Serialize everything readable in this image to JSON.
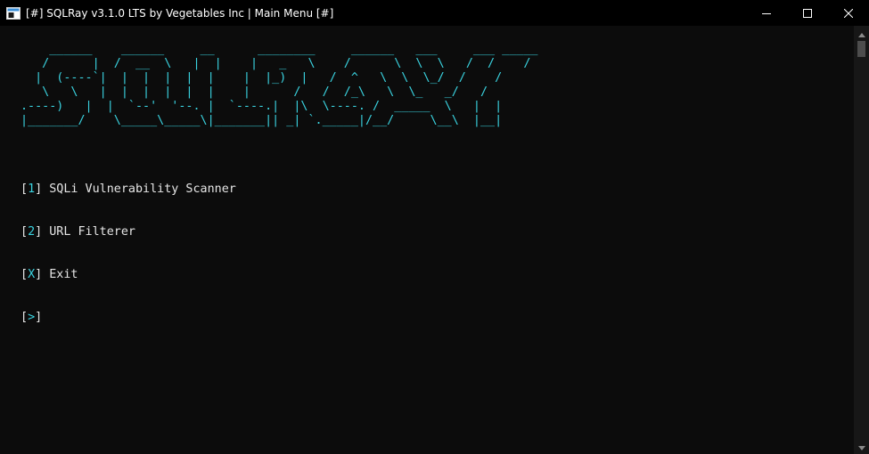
{
  "window": {
    "title": "[#] SQLRay v3.1.0 LTS by Vegetables Inc | Main Menu [#]",
    "app_icon": "console-icon",
    "controls": [
      "minimize-icon",
      "maximize-icon",
      "close-icon"
    ]
  },
  "console": {
    "banner_lines": [
      "    ______    ______     __      ________     ______   ___     ___ _____",
      "   /      |  /  __  \\   |  |    |   _   \\    /      \\  \\  \\   /  /    /",
      "  |  (----`|  |  |  |  |  |    |  |_)  |   /  ^   \\  \\  \\_/  /    /",
      "   \\   \\   |  |  |  |  |  |    |      /   /  /_\\   \\  \\_   _/   /",
      ".----)   |  |  `--'  '--. |  `----.|  |\\  \\----. /  _____  \\   |  |",
      "|_______/    \\_____\\_____\\|_______|| _| `._____|/__/     \\__\\  |__|"
    ],
    "banner_color": "#3ad3e0",
    "text_color": "#e6e6e6",
    "menu": [
      {
        "key": "1",
        "label": "SQLi Vulnerability Scanner"
      },
      {
        "key": "2",
        "label": "URL Filterer"
      },
      {
        "key": "X",
        "label": "Exit"
      }
    ],
    "prompt_key": ">"
  }
}
